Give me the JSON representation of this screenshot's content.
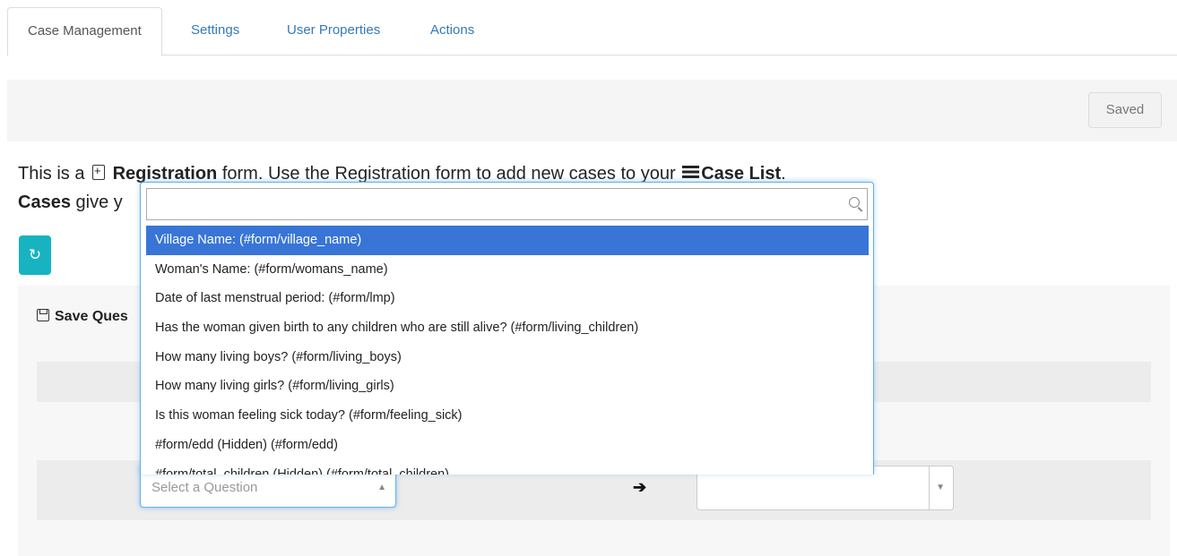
{
  "tabs": [
    {
      "label": "Case Management",
      "active": true
    },
    {
      "label": "Settings"
    },
    {
      "label": "User Properties"
    },
    {
      "label": "Actions"
    }
  ],
  "savebar": {
    "saved_label": "Saved"
  },
  "intro": {
    "line1_pre": "This is a",
    "form_type": "Registration",
    "line1_mid": "form. Use the Registration form to add new cases to your",
    "case_list": "Case List",
    "line1_end": ".",
    "line2_bold": "Cases",
    "line2_text": "give y"
  },
  "panel": {
    "title": "Save Ques"
  },
  "question_select": {
    "placeholder": "Select a Question"
  },
  "dropdown": {
    "search_value": "",
    "items": [
      "Village Name: (#form/village_name)",
      "Woman's Name: (#form/womans_name)",
      "Date of last menstrual period: (#form/lmp)",
      "Has the woman given birth to any children who are still alive? (#form/living_children)",
      "How many living boys? (#form/living_boys)",
      "How many living girls? (#form/living_girls)",
      "Is this woman feeling sick today? (#form/feeling_sick)",
      "#form/edd (Hidden) (#form/edd)",
      "#form/total_children (Hidden) (#form/total_children)"
    ],
    "selected_index": 0
  },
  "icons": {
    "doc": "file-plus-icon",
    "list": "list-icon",
    "refresh": "refresh-icon",
    "save": "floppy-disk-icon",
    "search": "search-icon",
    "arrow": "arrow-right-icon"
  },
  "colors": {
    "accent": "#3875d7",
    "refresh_button": "#17b3c1",
    "link": "#337ab7"
  }
}
